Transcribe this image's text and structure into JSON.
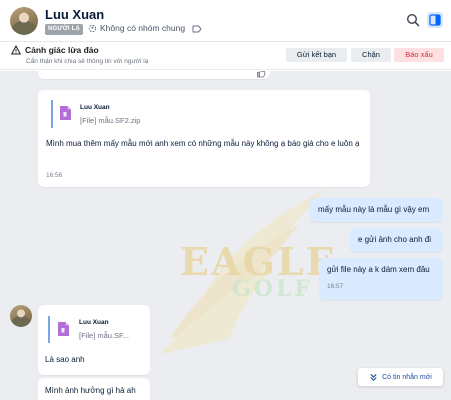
{
  "header": {
    "name": "Luu Xuan",
    "badge": "NGƯỜI LẠ",
    "group_label": "Không có nhóm chung",
    "icons": [
      "avatar",
      "people-icon",
      "tag-icon",
      "search-icon",
      "side-panel-icon"
    ]
  },
  "warning": {
    "title": "Cảnh giác lừa đảo",
    "subtitle": "Cẩn thận khi chia sẻ thông tin với người lạ",
    "buttons": {
      "add_friend": "Gửi kết bạn",
      "block": "Chặn",
      "report": "Báo xấu"
    }
  },
  "messages": {
    "m1": {
      "file_sender": "Luu Xuan",
      "file_name": "[File] mẫu.SF2.zip",
      "text": "Mình mua thêm mấy mẫu mới anh xem có những mẫu này không ạ  báo giá cho e luôn ạ",
      "time": "16:56"
    },
    "m2": {
      "text": "mấy mẫu này là mẫu gì vậy em"
    },
    "m3": {
      "text": "e gửi ảnh cho anh đi"
    },
    "m4": {
      "text": "gửi file này a k dám xem đâu",
      "time": "16:57"
    },
    "m5": {
      "file_sender": "Luu Xuan",
      "file_name": "[File] mẫu.SF...",
      "text": "Là sao anh"
    },
    "m6": {
      "text": "Mình ảnh hưởng gì hả ah"
    }
  },
  "watermark": {
    "line1": "EAGLE",
    "line2": "GOLF"
  },
  "new_message_label": "Có tin nhắn mới",
  "colors": {
    "accent": "#0068ff",
    "report_bg": "#fde0e2",
    "report_text": "#d92b3a",
    "chat_bg": "#ebedf0",
    "my_bubble": "#dbebff"
  }
}
